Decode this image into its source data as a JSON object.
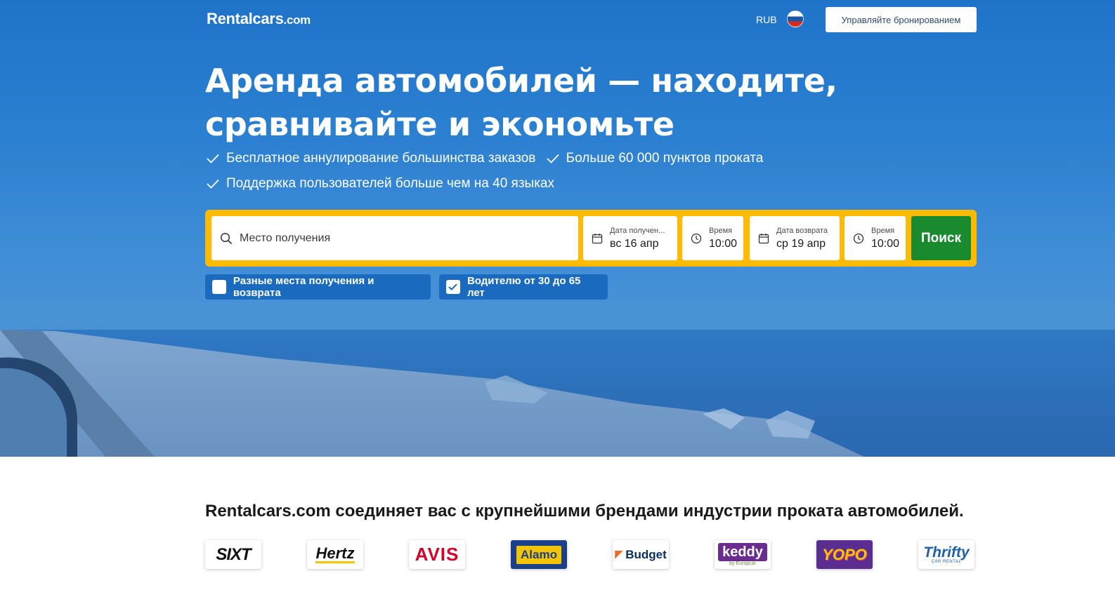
{
  "header": {
    "logo_text": "Rentalcars",
    "logo_suffix": ".com",
    "currency": "RUB",
    "flag_icon": "russia-flag-icon",
    "manage_booking_label": "Управляйте бронированием"
  },
  "hero": {
    "headline": "Аренда автомобилей — находите, сравнивайте и экономьте",
    "benefits": [
      "Бесплатное аннулирование большинства заказов",
      "Больше 60 000 пунктов проката",
      "Поддержка пользователей больше чем на 40 языках"
    ]
  },
  "search": {
    "location_placeholder": "Место получения",
    "pickup_date_label": "Дата получен...",
    "pickup_date_value": "вс 16 апр",
    "pickup_time_label": "Время",
    "pickup_time_value": "10:00",
    "return_date_label": "Дата возврата",
    "return_date_value": "ср 19 апр",
    "return_time_label": "Время",
    "return_time_value": "10:00",
    "search_label": "Поиск",
    "options": {
      "different_locations_label": "Разные места получения и возврата",
      "different_locations_checked": false,
      "driver_age_label": "Водителю от 30 до 65 лет",
      "driver_age_checked": true
    }
  },
  "brands": {
    "title": "Rentalcars.com соединяет вас с крупнейшими брендами индустрии проката автомобилей.",
    "logos": [
      "SIXT",
      "Hertz",
      "AVIS",
      "Alamo",
      "Budget",
      "keddy",
      "by Europcar",
      "YOPO",
      "Thrifty",
      "CAR RENTAL"
    ]
  },
  "colors": {
    "hero_blue": "#2c80d1",
    "search_frame": "#febb02",
    "search_button": "#1a8a2e",
    "option_chip": "#1a6bbf"
  }
}
